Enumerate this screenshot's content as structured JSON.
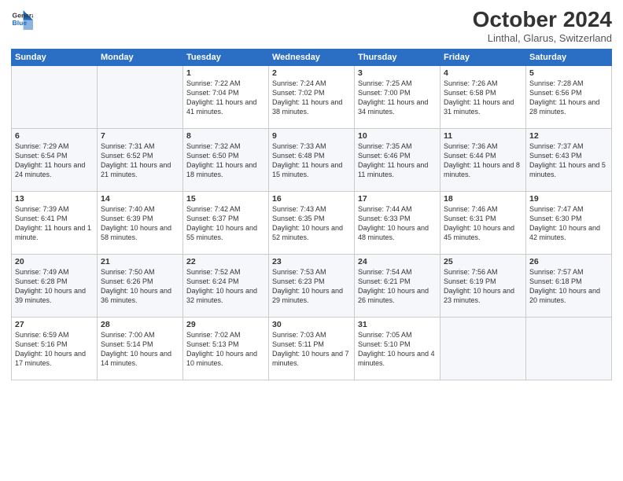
{
  "logo": {
    "general": "General",
    "blue": "Blue"
  },
  "title": "October 2024",
  "location": "Linthal, Glarus, Switzerland",
  "headers": [
    "Sunday",
    "Monday",
    "Tuesday",
    "Wednesday",
    "Thursday",
    "Friday",
    "Saturday"
  ],
  "weeks": [
    [
      {
        "day": "",
        "info": ""
      },
      {
        "day": "",
        "info": ""
      },
      {
        "day": "1",
        "info": "Sunrise: 7:22 AM\nSunset: 7:04 PM\nDaylight: 11 hours and 41 minutes."
      },
      {
        "day": "2",
        "info": "Sunrise: 7:24 AM\nSunset: 7:02 PM\nDaylight: 11 hours and 38 minutes."
      },
      {
        "day": "3",
        "info": "Sunrise: 7:25 AM\nSunset: 7:00 PM\nDaylight: 11 hours and 34 minutes."
      },
      {
        "day": "4",
        "info": "Sunrise: 7:26 AM\nSunset: 6:58 PM\nDaylight: 11 hours and 31 minutes."
      },
      {
        "day": "5",
        "info": "Sunrise: 7:28 AM\nSunset: 6:56 PM\nDaylight: 11 hours and 28 minutes."
      }
    ],
    [
      {
        "day": "6",
        "info": "Sunrise: 7:29 AM\nSunset: 6:54 PM\nDaylight: 11 hours and 24 minutes."
      },
      {
        "day": "7",
        "info": "Sunrise: 7:31 AM\nSunset: 6:52 PM\nDaylight: 11 hours and 21 minutes."
      },
      {
        "day": "8",
        "info": "Sunrise: 7:32 AM\nSunset: 6:50 PM\nDaylight: 11 hours and 18 minutes."
      },
      {
        "day": "9",
        "info": "Sunrise: 7:33 AM\nSunset: 6:48 PM\nDaylight: 11 hours and 15 minutes."
      },
      {
        "day": "10",
        "info": "Sunrise: 7:35 AM\nSunset: 6:46 PM\nDaylight: 11 hours and 11 minutes."
      },
      {
        "day": "11",
        "info": "Sunrise: 7:36 AM\nSunset: 6:44 PM\nDaylight: 11 hours and 8 minutes."
      },
      {
        "day": "12",
        "info": "Sunrise: 7:37 AM\nSunset: 6:43 PM\nDaylight: 11 hours and 5 minutes."
      }
    ],
    [
      {
        "day": "13",
        "info": "Sunrise: 7:39 AM\nSunset: 6:41 PM\nDaylight: 11 hours and 1 minute."
      },
      {
        "day": "14",
        "info": "Sunrise: 7:40 AM\nSunset: 6:39 PM\nDaylight: 10 hours and 58 minutes."
      },
      {
        "day": "15",
        "info": "Sunrise: 7:42 AM\nSunset: 6:37 PM\nDaylight: 10 hours and 55 minutes."
      },
      {
        "day": "16",
        "info": "Sunrise: 7:43 AM\nSunset: 6:35 PM\nDaylight: 10 hours and 52 minutes."
      },
      {
        "day": "17",
        "info": "Sunrise: 7:44 AM\nSunset: 6:33 PM\nDaylight: 10 hours and 48 minutes."
      },
      {
        "day": "18",
        "info": "Sunrise: 7:46 AM\nSunset: 6:31 PM\nDaylight: 10 hours and 45 minutes."
      },
      {
        "day": "19",
        "info": "Sunrise: 7:47 AM\nSunset: 6:30 PM\nDaylight: 10 hours and 42 minutes."
      }
    ],
    [
      {
        "day": "20",
        "info": "Sunrise: 7:49 AM\nSunset: 6:28 PM\nDaylight: 10 hours and 39 minutes."
      },
      {
        "day": "21",
        "info": "Sunrise: 7:50 AM\nSunset: 6:26 PM\nDaylight: 10 hours and 36 minutes."
      },
      {
        "day": "22",
        "info": "Sunrise: 7:52 AM\nSunset: 6:24 PM\nDaylight: 10 hours and 32 minutes."
      },
      {
        "day": "23",
        "info": "Sunrise: 7:53 AM\nSunset: 6:23 PM\nDaylight: 10 hours and 29 minutes."
      },
      {
        "day": "24",
        "info": "Sunrise: 7:54 AM\nSunset: 6:21 PM\nDaylight: 10 hours and 26 minutes."
      },
      {
        "day": "25",
        "info": "Sunrise: 7:56 AM\nSunset: 6:19 PM\nDaylight: 10 hours and 23 minutes."
      },
      {
        "day": "26",
        "info": "Sunrise: 7:57 AM\nSunset: 6:18 PM\nDaylight: 10 hours and 20 minutes."
      }
    ],
    [
      {
        "day": "27",
        "info": "Sunrise: 6:59 AM\nSunset: 5:16 PM\nDaylight: 10 hours and 17 minutes."
      },
      {
        "day": "28",
        "info": "Sunrise: 7:00 AM\nSunset: 5:14 PM\nDaylight: 10 hours and 14 minutes."
      },
      {
        "day": "29",
        "info": "Sunrise: 7:02 AM\nSunset: 5:13 PM\nDaylight: 10 hours and 10 minutes."
      },
      {
        "day": "30",
        "info": "Sunrise: 7:03 AM\nSunset: 5:11 PM\nDaylight: 10 hours and 7 minutes."
      },
      {
        "day": "31",
        "info": "Sunrise: 7:05 AM\nSunset: 5:10 PM\nDaylight: 10 hours and 4 minutes."
      },
      {
        "day": "",
        "info": ""
      },
      {
        "day": "",
        "info": ""
      }
    ]
  ]
}
